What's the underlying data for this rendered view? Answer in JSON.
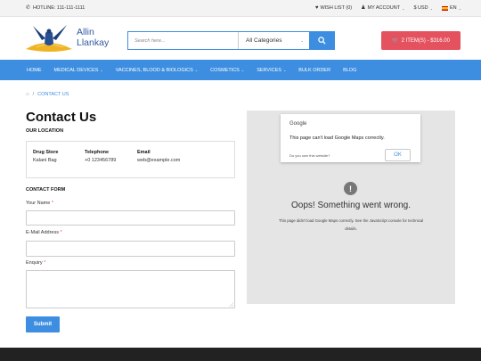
{
  "topbar": {
    "hotline": "HOTLINE: 111-111-1111",
    "wishlist": "WISH LIST (0)",
    "account": "MY ACCOUNT",
    "currency": "$ USD",
    "language": "EN"
  },
  "header": {
    "logo_line1": "Allin",
    "logo_line2": "Llankay",
    "search_placeholder": "Search here...",
    "category_selected": "All Categories",
    "cart_label": "2 ITEM(S) - $316.00"
  },
  "nav": {
    "items": [
      {
        "label": "HOME"
      },
      {
        "label": "MEDICAL DEVICES"
      },
      {
        "label": "VACCINES, BLOOD & BIOLOGICS"
      },
      {
        "label": "COSMETICS"
      },
      {
        "label": "SERVICES"
      },
      {
        "label": "BULK ORDER"
      },
      {
        "label": "BLOG"
      }
    ]
  },
  "breadcrumb": {
    "separator": "/",
    "current": "CONTACT US"
  },
  "page": {
    "title": "Contact Us",
    "location_heading": "OUR LOCATION",
    "location": {
      "store_label": "Drug Store",
      "store_value": "Kalani Bag",
      "phone_label": "Telephone",
      "phone_value": "+0 123456789",
      "email_label": "Email",
      "email_value": "web@example.com"
    },
    "form_heading": "CONTACT FORM",
    "name_label": "Your Name",
    "email_label": "E-Mail Address",
    "enquiry_label": "Enquiry",
    "required_mark": "*",
    "submit_label": "Submit"
  },
  "map": {
    "google_label": "Google",
    "dialog_message": "This page can't load Google Maps correctly.",
    "own_site": "Do you own this website?",
    "ok_label": "OK",
    "error_icon": "!",
    "error_title": "Oops! Something went wrong.",
    "error_desc": "This page didn't load Google Maps correctly. See the JavaScript console for technical details."
  },
  "colors": {
    "accent": "#3d8ee0",
    "cart": "#e4525f",
    "footer": "#222222"
  }
}
